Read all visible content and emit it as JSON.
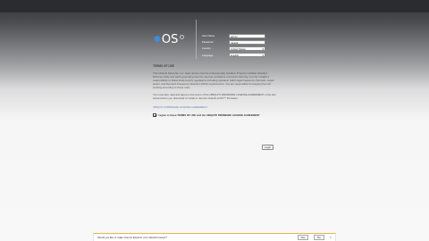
{
  "logo": {
    "prefix": "●",
    "text": "OS"
  },
  "login_form": {
    "fields": [
      {
        "label": "User Name",
        "value": "admin"
      },
      {
        "label": "Password",
        "value": "●●●●●"
      },
      {
        "label": "Country",
        "value": "United States"
      },
      {
        "label": "Language",
        "value": "English"
      }
    ]
  },
  "content": {
    "heading": "TERMS OF USE",
    "paragraphs": [
      "This Ubiquiti Networks, Inc. radio device must be professionally installed. Properly installed shielded Ethernet cable and earth grounding must be used as conditions of product warranty. It is the installer's responsibility to follow local country regulations including operation within legal frequency channels, output power, and Dynamic Frequency Selection (DFS) requirements. You are responsible for keeping the unit working according to these rules.",
      "You must also read and agree to the terms of the UBIQUITI FIRMWARE LICENSE AGREEMENT in the link below before you download or install or use the Ubiquiti airOS™ Firmware."
    ],
    "link": "UBIQUITI FIRMWARE LICENSE AGREEMENT",
    "agree_label": "I agree to these TERMS OF USE and the UBIQUITI FIRMWARE LICENSE AGREEMENT"
  },
  "buttons": {
    "login": "Login"
  },
  "notification": {
    "message": "Would you like to make Internet Explorer your default browser?",
    "yes": "Yes",
    "no": "No",
    "close": "×"
  }
}
